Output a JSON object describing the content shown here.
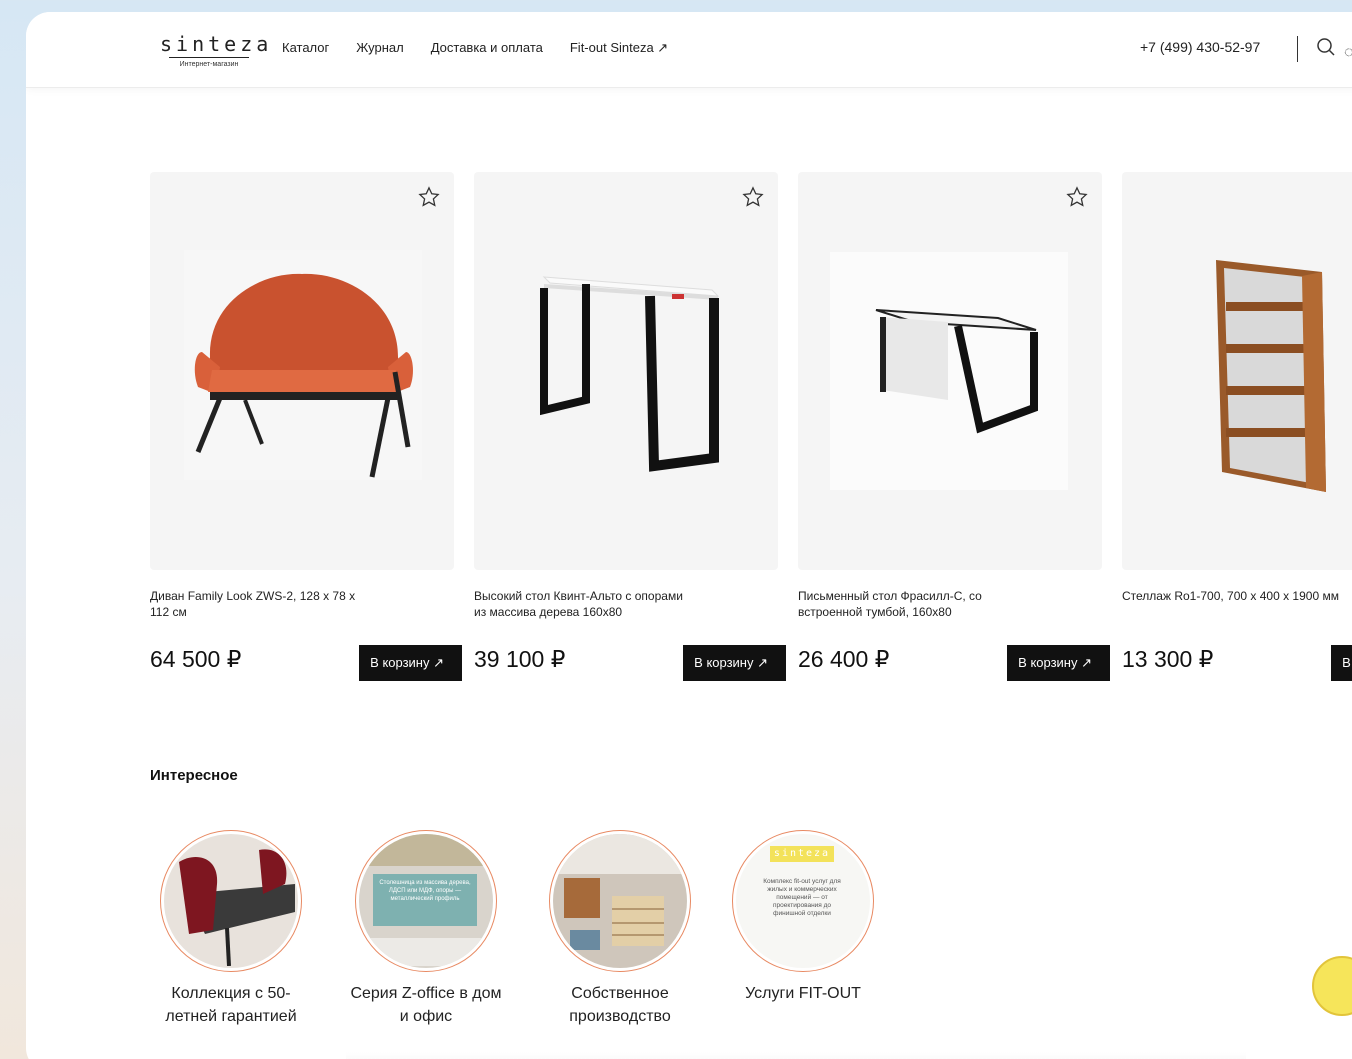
{
  "header": {
    "logo_word": "sinteza",
    "logo_sub": "Интернет-магазин",
    "nav": [
      "Каталог",
      "Журнал",
      "Доставка и оплата",
      "Fit-out Sinteza ↗"
    ],
    "phone": "+7 (499) 430-52-97"
  },
  "products": [
    {
      "name": "Диван Family Look ZWS-2, 128 x 78 x 112 см",
      "price": "64 500 ₽",
      "cart_label": "В корзину ↗"
    },
    {
      "name": "Высокий стол Квинт-Альто с опорами из массива дерева 160x80",
      "price": "39 100 ₽",
      "cart_label": "В корзину ↗"
    },
    {
      "name": "Письменный стол Фрасилл-С, со встроенной тумбой, 160x80",
      "price": "26 400 ₽",
      "cart_label": "В корзину ↗"
    },
    {
      "name": "Стеллаж Ro1-700, 700 x 400 x 1900 мм",
      "price": "13 300 ₽",
      "cart_label": "В корзину ↗"
    }
  ],
  "section_title": "Интересное",
  "stories": [
    {
      "label": "Коллекция с 50-летней гарантией"
    },
    {
      "label": "Серия Z-office в дом и офис",
      "inner_text": "Столешница из массива дерева, ЛДСП или МДФ, опоры — металлический профиль"
    },
    {
      "label": "Собственное производство"
    },
    {
      "label": "Услуги FIT-OUT",
      "inner_logo": "sinteza",
      "inner_text": "Комплекс fit-out услуг для жилых и коммерческих помещений — от проектирования до финишной отделки"
    }
  ],
  "colors": {
    "accent_ring": "#e88a63",
    "button_bg": "#111111",
    "chat": "#f6e55a"
  }
}
